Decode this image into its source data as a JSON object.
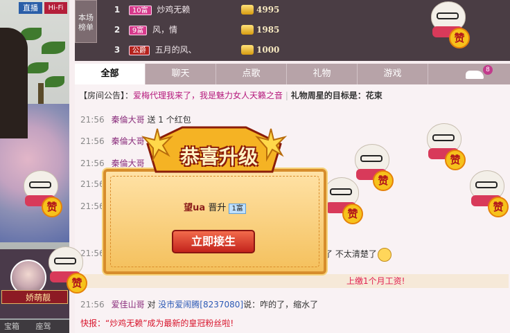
{
  "video": {
    "live_label": "直播",
    "hifi_label": "Hi-Fi"
  },
  "host": {
    "name": "娇萌靓"
  },
  "bottom_left": {
    "items": [
      "宝箱",
      "座驾"
    ]
  },
  "ranking": {
    "title": "本场榜单",
    "rows": [
      {
        "rank": "1",
        "level": "10富",
        "name": "炒鸡无赖",
        "coins": "4995"
      },
      {
        "rank": "2",
        "level": "9富",
        "name": "风，情",
        "coins": "1985"
      },
      {
        "rank": "3",
        "level": "公爵",
        "name": "五月的风、",
        "coins": "1000"
      }
    ]
  },
  "tabs": {
    "items": [
      "全部",
      "聊天",
      "点歌",
      "礼物",
      "游戏"
    ],
    "badge_count": "8"
  },
  "notice": {
    "label": "【房间公告】：",
    "text": "爱梅代理我来了，我是魅力女人天籁之音",
    "separator": "|",
    "gift_text": "礼物周星的目标是：花束"
  },
  "chat": {
    "lines": [
      {
        "time": "21:56",
        "user": "秦倫大哥",
        "text": "送 1 个红包"
      },
      {
        "time": "21:56",
        "user": "秦倫大哥",
        "text": ""
      },
      {
        "time": "21:56",
        "user": "秦倫大哥",
        "text": ""
      },
      {
        "time": "21:56",
        "user": "",
        "text": ""
      },
      {
        "time": "21:56",
        "user": "",
        "text": ""
      },
      {
        "time": "21:56",
        "user": "",
        "text": ""
      }
    ],
    "line_tail": "了 不太清楚了",
    "banner": "上缴1个月工资!",
    "last_line": {
      "time": "21:56",
      "user": "爱佳山哥",
      "mid": "对",
      "target": "没市爱闹腾[8237080]",
      "verb": "说：",
      "text": "咋的了，缩水了"
    },
    "express": "快报：“炒鸡无赖”成为最新的皇冠粉丝啦!"
  },
  "popup": {
    "title": "恭喜升级",
    "user": "望ua",
    "action": "晋升",
    "level": "1富",
    "button": "立即接生"
  },
  "praise": {
    "label": "赞"
  },
  "colors": {
    "accent": "#b5197c",
    "popup_button": "#c3231c",
    "header": "#4a3d44"
  }
}
